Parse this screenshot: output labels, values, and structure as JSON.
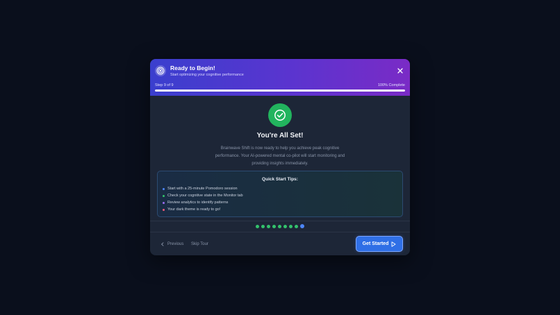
{
  "header": {
    "title": "Ready to Begin!",
    "subtitle": "Start optimizing your cognitive performance",
    "step_label": "Step 9 of 9",
    "complete_label": "100% Complete",
    "progress": 1.0,
    "icon": "target-icon"
  },
  "main": {
    "title": "You're All Set!",
    "description": "Brainwave Shift is now ready to help you achieve peak cognitive performance. Your AI-powered mental co-pilot will start monitoring and providing insights immediately.",
    "icon": "check-circle-icon"
  },
  "tips": {
    "title": "Quick Start Tips:",
    "items": [
      {
        "text": "Start with a 25-minute Pomodoro session",
        "color": "#4d86f7"
      },
      {
        "text": "Check your cognitive state in the Monitor tab",
        "color": "#33c26c"
      },
      {
        "text": "Review analytics to identify patterns",
        "color": "#9b6cf0"
      },
      {
        "text": "Your dark theme is ready to go!",
        "color": "#ef5b7a"
      }
    ]
  },
  "steps": {
    "total": 9,
    "current": 9
  },
  "footer": {
    "previous_label": "Previous",
    "skip_label": "Skip Tour",
    "primary_label": "Get Started"
  },
  "colors": {
    "accent": "#2f6fe6",
    "success": "#22b45e",
    "header_start": "#3a3fce",
    "header_end": "#7a2bc6"
  }
}
